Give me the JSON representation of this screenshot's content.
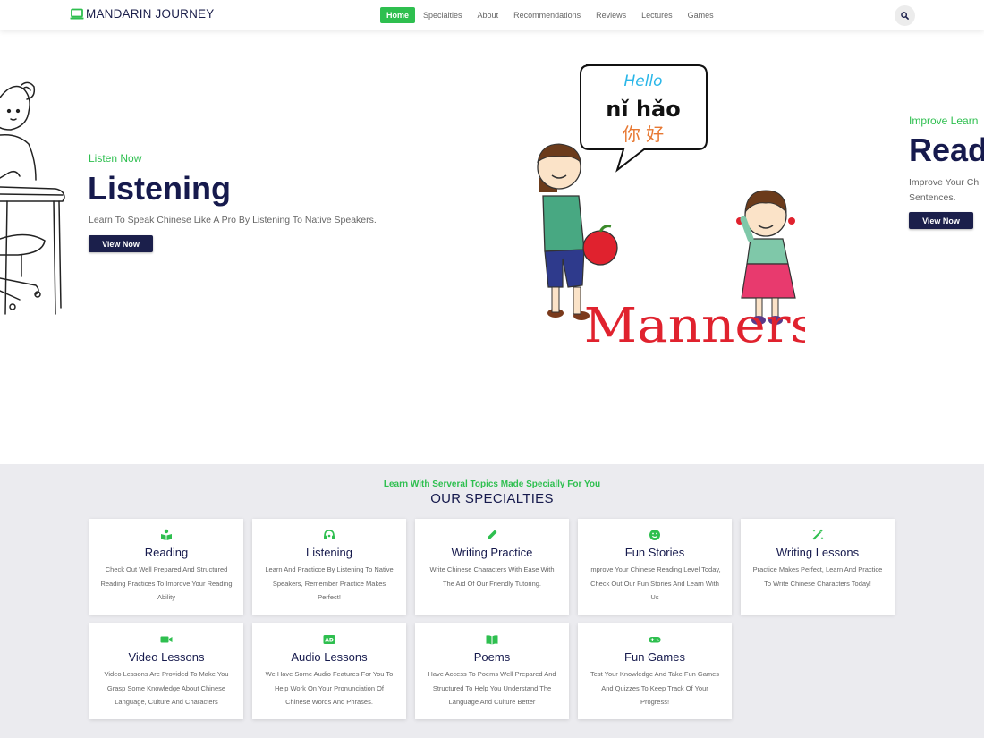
{
  "nav": {
    "brand": "MANDARIN JOURNEY",
    "items": [
      "Home",
      "Specialties",
      "About",
      "Recommendations",
      "Reviews",
      "Lectures",
      "Games"
    ],
    "active": "Home"
  },
  "hero": {
    "slide1": {
      "subtitle": "Listen Now",
      "title": "Listening",
      "description": "Learn To Speak Chinese Like A Pro By Listening To Native Speakers.",
      "button": "View Now"
    },
    "art": {
      "bubble_en": "Hello",
      "bubble_pinyin": "nǐ hǎo",
      "bubble_hanzi": "你 好",
      "caption": "Manners"
    },
    "slide2": {
      "subtitle": "Improve Learn",
      "title": "Read",
      "description_line1": "Improve Your Ch",
      "description_line2": "Sentences.",
      "button": "View Now"
    }
  },
  "specialties": {
    "subtitle": "Learn With Serveral Topics Made Specially For You",
    "title": "OUR SPECIALTIES",
    "cards": [
      {
        "icon": "reading-icon",
        "title": "Reading",
        "desc": "Check Out Well Prepared And Structured Reading Practices To Improve Your Reading Ability"
      },
      {
        "icon": "headset-icon",
        "title": "Listening",
        "desc": "Learn And Practicce By Listening To Native Speakers, Remember Practice Makes Perfect!"
      },
      {
        "icon": "pencil-icon",
        "title": "Writing Practice",
        "desc": "Write Chinese Characters With Ease With The Aid Of Our Friendly Tutoring."
      },
      {
        "icon": "smile-icon",
        "title": "Fun Stories",
        "desc": "Improve Your Chinese Reading Level Today, Check Out Our Fun Stories And Learn With Us"
      },
      {
        "icon": "magic-wand-icon",
        "title": "Writing Lessons",
        "desc": "Practice Makes Perfect, Learn And Practice To Write Chinese Characters Today!"
      },
      {
        "icon": "video-icon",
        "title": "Video Lessons",
        "desc": "Video Lessons Are Provided To Make You Grasp Some Knowledge About Chinese Language, Culture And Characters"
      },
      {
        "icon": "audio-description-icon",
        "title": "Audio Lessons",
        "desc": "We Have Some Audio Features For You To Help Work On Your Pronunciation Of Chinese Words And Phrases."
      },
      {
        "icon": "open-book-icon",
        "title": "Poems",
        "desc": "Have Access To Poems Well Prepared And Structured To Help You Understand The Language And Culture Better"
      },
      {
        "icon": "gamepad-icon",
        "title": "Fun Games",
        "desc": "Test Your Knowledge And Take Fun Games And Quizzes To Keep Track Of Your Progress!"
      }
    ]
  },
  "colors": {
    "accent": "#2ebf4f",
    "navy": "#161a4d",
    "section_bg": "#ebebef"
  }
}
